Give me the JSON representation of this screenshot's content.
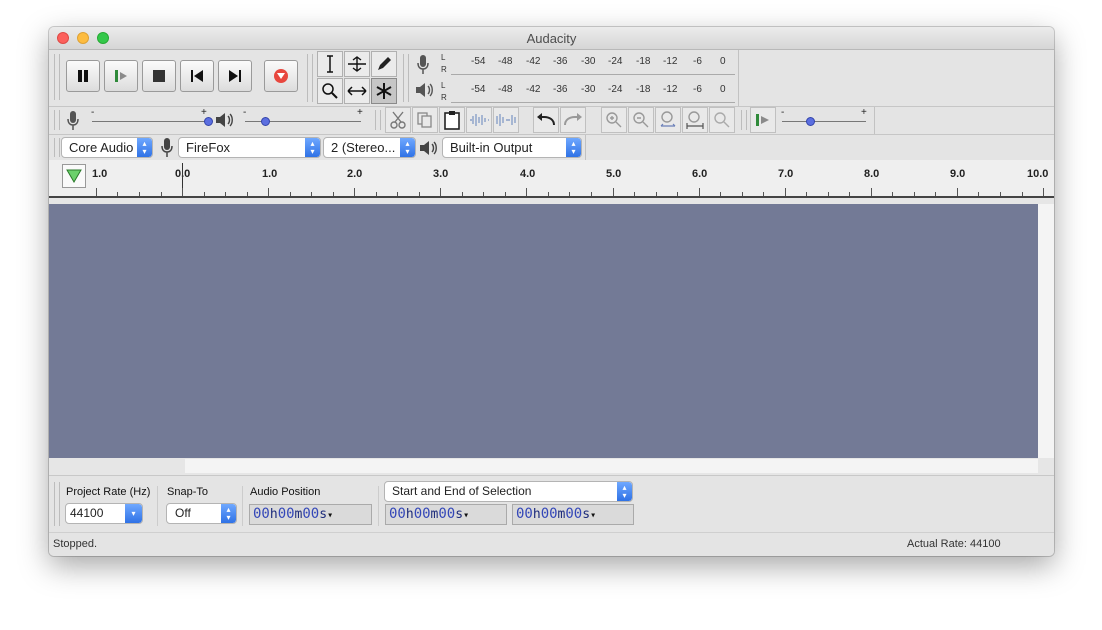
{
  "window": {
    "title": "Audacity"
  },
  "meters": {
    "record": {
      "channels": [
        "L",
        "R"
      ],
      "ticks": [
        "-54",
        "-48",
        "-42",
        "-36",
        "-30",
        "-24",
        "-18",
        "-12",
        "-6",
        "0"
      ]
    },
    "playback": {
      "channels": [
        "L",
        "R"
      ],
      "ticks": [
        "-54",
        "-48",
        "-42",
        "-36",
        "-30",
        "-24",
        "-18",
        "-12",
        "-6",
        "0"
      ]
    }
  },
  "mixer": {
    "record_minus": "-",
    "record_plus": "+",
    "play_minus": "-",
    "play_plus": "+",
    "record_level": 1.0,
    "play_level": 0.2
  },
  "play_at_speed": {
    "minus": "-",
    "plus": "+",
    "level": 0.35
  },
  "device": {
    "host": "Core Audio",
    "recording_device": "FireFox",
    "channels": "2 (Stereo...",
    "playback_device": "Built-in Output"
  },
  "ruler": {
    "labels": [
      "1.0",
      "0.0",
      "1.0",
      "2.0",
      "3.0",
      "4.0",
      "5.0",
      "6.0",
      "7.0",
      "8.0",
      "9.0",
      "10.0"
    ]
  },
  "selection_bar": {
    "project_rate_label": "Project Rate (Hz)",
    "project_rate": "44100",
    "snap_to_label": "Snap-To",
    "snap_to": "Off",
    "audio_position_label": "Audio Position",
    "selection_mode": "Start and End of Selection",
    "audio_position": {
      "h": "00",
      "m": "00",
      "s": "00"
    },
    "selection_start": {
      "h": "00",
      "m": "00",
      "s": "00"
    },
    "selection_end": {
      "h": "00",
      "m": "00",
      "s": "00"
    },
    "unit_h": "h",
    "unit_m": "m",
    "unit_s": "s"
  },
  "status": {
    "state": "Stopped.",
    "actual_rate": "Actual Rate: 44100"
  },
  "colors": {
    "track_bg": "#737a96",
    "record_red": "#e8473e",
    "slider_blue": "#5b6ee0"
  }
}
